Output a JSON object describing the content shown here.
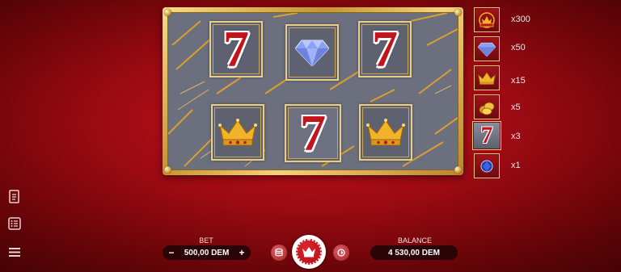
{
  "board": {
    "row1": [
      "seven",
      "diamond",
      "seven"
    ],
    "row2": [
      "crown",
      "seven",
      "crown"
    ]
  },
  "symbols": {
    "seven": "7"
  },
  "paytable": [
    {
      "symbol": "jackpot-emblem",
      "multiplier": "x300"
    },
    {
      "symbol": "diamond",
      "multiplier": "x50"
    },
    {
      "symbol": "crown",
      "multiplier": "x15"
    },
    {
      "symbol": "gold-coins",
      "multiplier": "x5"
    },
    {
      "symbol": "seven",
      "multiplier": "x3",
      "highlighted": true
    },
    {
      "symbol": "sapphire",
      "multiplier": "x1"
    }
  ],
  "side_menu": [
    "rules-icon",
    "history-icon",
    "menu-icon"
  ],
  "controls": {
    "bet_label": "BET",
    "bet_value": "500,00 DEM",
    "minus": "−",
    "plus": "+",
    "balance_label": "BALANCE",
    "balance_value": "4 530,00 DEM"
  },
  "colors": {
    "background": "#b10f17",
    "frame_gold": "#d9b257",
    "reel_gray": "#6c6f7e",
    "seven_red": "#c4141b"
  }
}
